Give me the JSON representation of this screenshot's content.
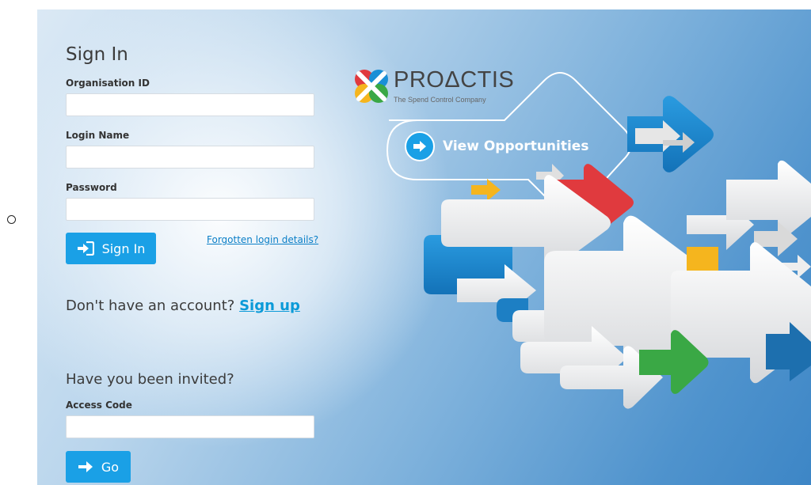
{
  "signin": {
    "title": "Sign In",
    "org_label": "Organisation ID",
    "org_value": "",
    "login_label": "Login Name",
    "login_value": "",
    "password_label": "Password",
    "password_value": "",
    "button_label": "Sign In",
    "forgot_link": "Forgotten login details?"
  },
  "signup": {
    "prompt": "Don't have an account?",
    "link": "Sign up"
  },
  "invite": {
    "title": "Have you been invited?",
    "code_label": "Access Code",
    "code_value": "",
    "button_label": "Go"
  },
  "brand": {
    "name": "PROΔCTIS",
    "tagline": "The Spend Control Company"
  },
  "cta": {
    "label": "View Opportunities"
  },
  "colors": {
    "accent": "#1aa0e6",
    "link": "#0b7fc7",
    "arrow_red": "#e03a3e",
    "arrow_blue": "#1a8fd6",
    "arrow_green": "#3aa845",
    "arrow_yellow": "#f5b51e"
  },
  "icons": {
    "signin_button": "login-arrow-icon",
    "go_button": "right-arrow-icon",
    "cta": "circle-arrow-icon",
    "logo": "proactis-logo-icon"
  }
}
